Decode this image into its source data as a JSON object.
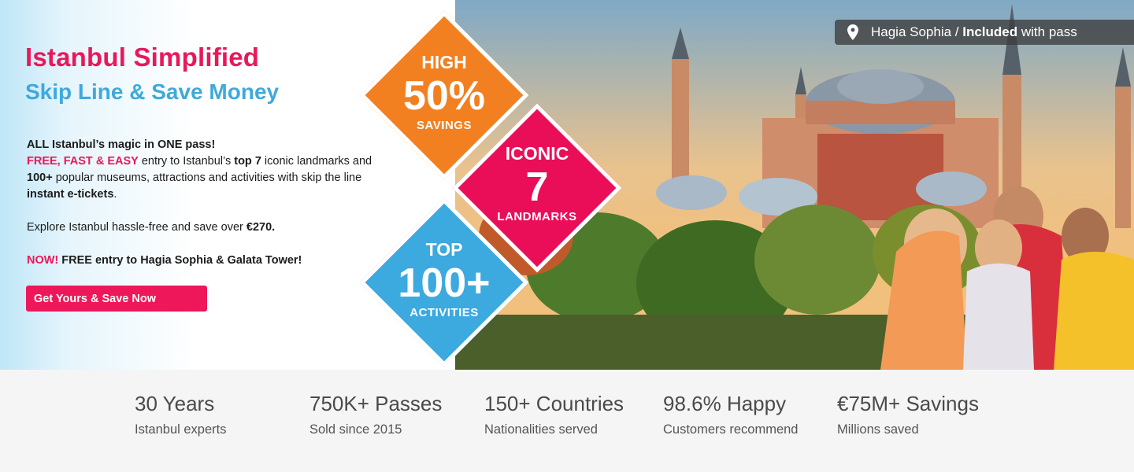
{
  "hero": {
    "title": "Istanbul Simplified",
    "subtitle": "Skip Line & Save Money",
    "desc": {
      "line1": "ALL Istanbul’s magic in ONE pass!",
      "line2_pink": "FREE, FAST & EASY",
      "line2_a": " entry to Istanbul’s ",
      "line2_bold": "top 7",
      "line2_b": " iconic landmarks and",
      "line3_bold": "100+",
      "line3_a": " popular museums, attractions and activities with skip the line",
      "line4_bold": "instant e-tickets",
      "line4_a": ".",
      "line5_a": "Explore Istanbul hassle-free and save over ",
      "line5_bold": "€270.",
      "line6_pink": "NOW!",
      "line6_bold": " FREE entry to Hagia Sophia & Galata Tower!"
    },
    "cta_label": "Get Yours & Save Now"
  },
  "diamonds": {
    "orange": {
      "top": "HIGH",
      "big": "50%",
      "bottom": "SAVINGS",
      "color": "#f28021"
    },
    "pink": {
      "top": "ICONIC",
      "big": "7",
      "bottom": "LANDMARKS",
      "color": "#ea0e58"
    },
    "blue": {
      "top": "TOP",
      "big": "100+",
      "bottom": "ACTIVITIES",
      "color": "#3ca9df"
    }
  },
  "location_badge": {
    "icon": "map-pin-icon",
    "place": "Hagia Sophia",
    "separator": " / ",
    "bold": "Included",
    "rest": " with pass"
  },
  "stats": [
    {
      "head": "30 Years",
      "sub": "Istanbul experts"
    },
    {
      "head": "750K+ Passes",
      "sub": "Sold since 2015"
    },
    {
      "head": "150+ Countries",
      "sub": "Nationalities served"
    },
    {
      "head": "98.6% Happy",
      "sub": "Customers recommend"
    },
    {
      "head": "€75M+ Savings",
      "sub": "Millions saved"
    }
  ],
  "colors": {
    "brand_pink": "#e8185a",
    "brand_blue": "#3fa9dc",
    "orange": "#f28021"
  }
}
